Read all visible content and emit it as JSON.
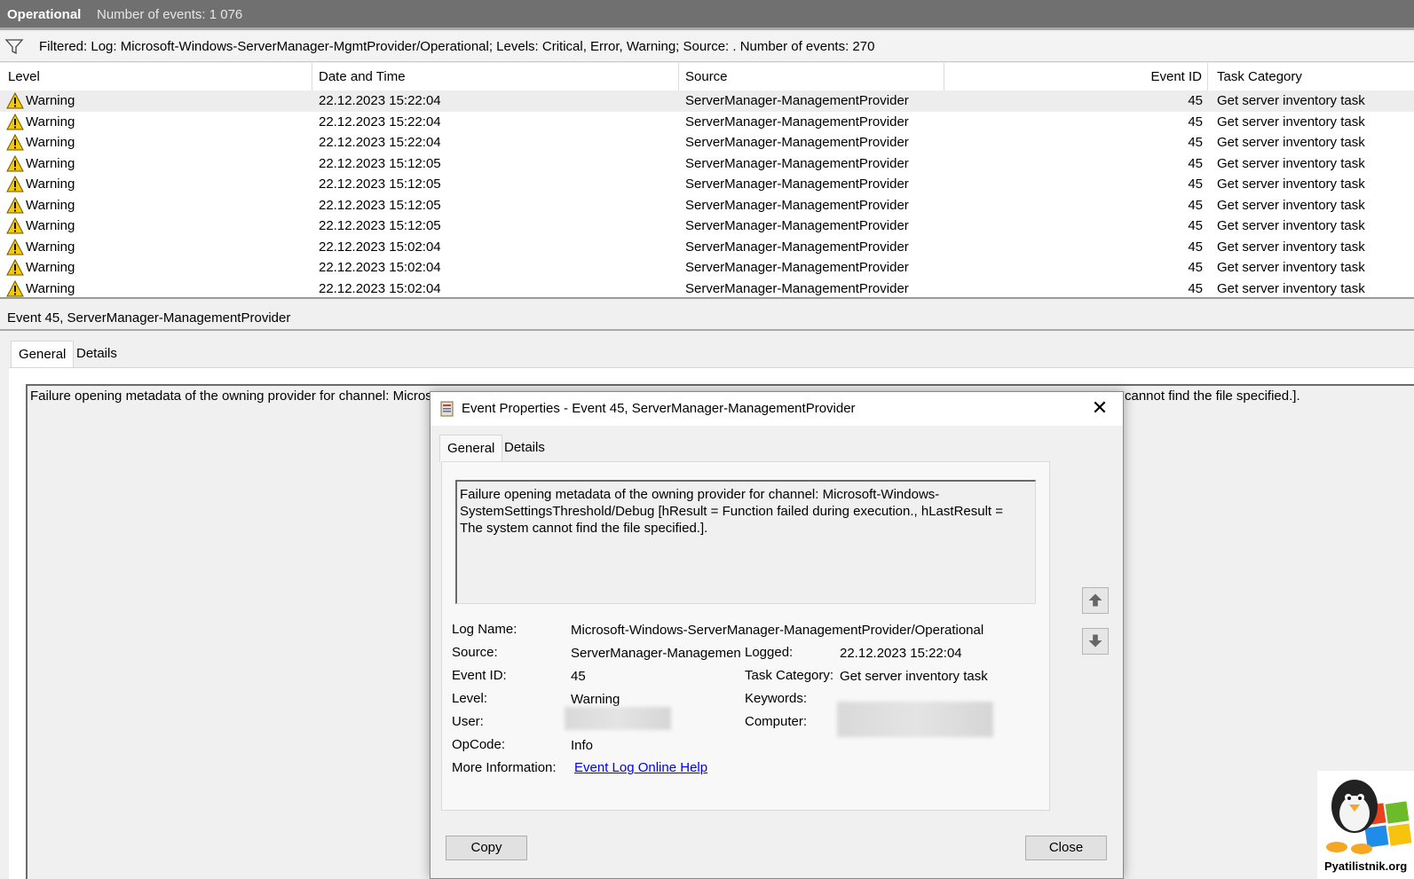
{
  "header": {
    "title": "Operational",
    "event_count": "Number of events: 1 076"
  },
  "filter": {
    "text": "Filtered: Log: Microsoft-Windows-ServerManager-MgmtProvider/Operational; Levels: Critical, Error, Warning; Source: . Number of events: 270"
  },
  "table": {
    "columns": [
      "Level",
      "Date and Time",
      "Source",
      "Event ID",
      "Task Category"
    ],
    "rows": [
      {
        "level": "Warning",
        "datetime": "22.12.2023 15:22:04",
        "source": "ServerManager-ManagementProvider",
        "event_id": "45",
        "task": "Get server inventory task"
      },
      {
        "level": "Warning",
        "datetime": "22.12.2023 15:22:04",
        "source": "ServerManager-ManagementProvider",
        "event_id": "45",
        "task": "Get server inventory task"
      },
      {
        "level": "Warning",
        "datetime": "22.12.2023 15:22:04",
        "source": "ServerManager-ManagementProvider",
        "event_id": "45",
        "task": "Get server inventory task"
      },
      {
        "level": "Warning",
        "datetime": "22.12.2023 15:12:05",
        "source": "ServerManager-ManagementProvider",
        "event_id": "45",
        "task": "Get server inventory task"
      },
      {
        "level": "Warning",
        "datetime": "22.12.2023 15:12:05",
        "source": "ServerManager-ManagementProvider",
        "event_id": "45",
        "task": "Get server inventory task"
      },
      {
        "level": "Warning",
        "datetime": "22.12.2023 15:12:05",
        "source": "ServerManager-ManagementProvider",
        "event_id": "45",
        "task": "Get server inventory task"
      },
      {
        "level": "Warning",
        "datetime": "22.12.2023 15:12:05",
        "source": "ServerManager-ManagementProvider",
        "event_id": "45",
        "task": "Get server inventory task"
      },
      {
        "level": "Warning",
        "datetime": "22.12.2023 15:02:04",
        "source": "ServerManager-ManagementProvider",
        "event_id": "45",
        "task": "Get server inventory task"
      },
      {
        "level": "Warning",
        "datetime": "22.12.2023 15:02:04",
        "source": "ServerManager-ManagementProvider",
        "event_id": "45",
        "task": "Get server inventory task"
      },
      {
        "level": "Warning",
        "datetime": "22.12.2023 15:02:04",
        "source": "ServerManager-ManagementProvider",
        "event_id": "45",
        "task": "Get server inventory task"
      }
    ]
  },
  "preview": {
    "title": "Event 45, ServerManager-ManagementProvider",
    "tabs": [
      "General",
      "Details"
    ],
    "text_left": "Failure opening metadata of the owning provider for channel: Micros",
    "text_right": "cannot find the file specified.]."
  },
  "dialog": {
    "title": "Event Properties - Event 45, ServerManager-ManagementProvider",
    "tabs": [
      "General",
      "Details"
    ],
    "message": "Failure opening metadata of the owning provider for channel: Microsoft-Windows-SystemSettingsThreshold/Debug [hResult = Function failed during execution., hLastResult = The system cannot find the file specified.].",
    "labels": {
      "log_name": "Log Name:",
      "source": "Source:",
      "event_id": "Event ID:",
      "level": "Level:",
      "user": "User:",
      "opcode": "OpCode:",
      "more_info": "More Information:",
      "logged": "Logged:",
      "task_category": "Task Category:",
      "keywords": "Keywords:",
      "computer": "Computer:"
    },
    "values": {
      "log_name": "Microsoft-Windows-ServerManager-ManagementProvider/Operational",
      "source": "ServerManager-Managemen",
      "event_id": "45",
      "level": "Warning",
      "opcode": "Info",
      "more_info_link": "Event Log Online Help",
      "logged": "22.12.2023 15:22:04",
      "task_category": "Get server inventory task"
    },
    "copy_button": "Copy",
    "close_button": "Close"
  },
  "logo": {
    "text": "Pyatilistnik.org"
  }
}
